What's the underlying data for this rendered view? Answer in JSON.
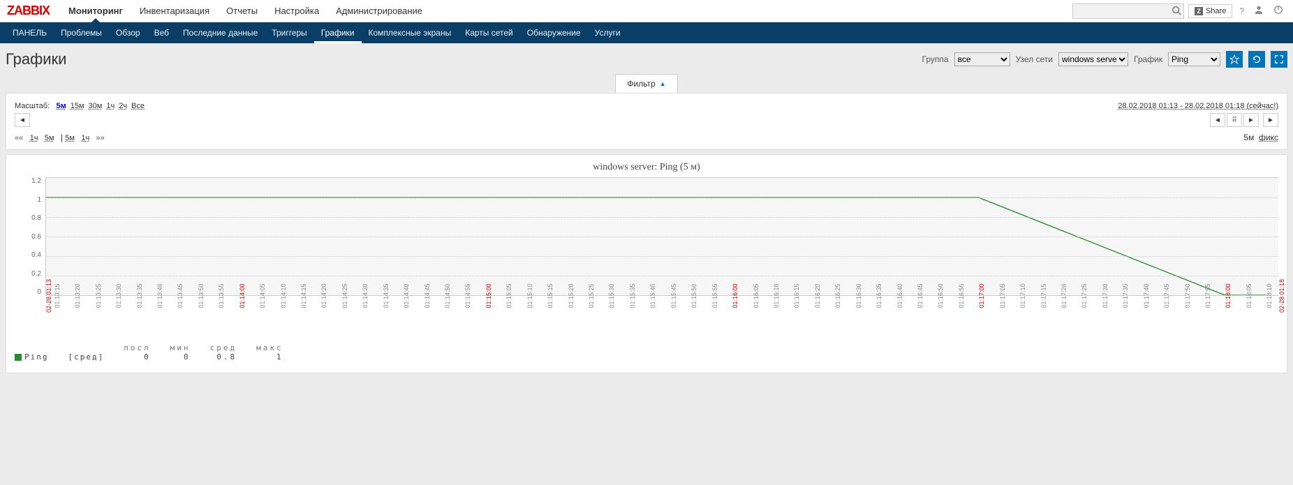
{
  "logo": "ZABBIX",
  "topnav": [
    {
      "label": "Мониторинг",
      "active": true
    },
    {
      "label": "Инвентаризация"
    },
    {
      "label": "Отчеты"
    },
    {
      "label": "Настройка"
    },
    {
      "label": "Администрирование"
    }
  ],
  "share_label": "Share",
  "subnav": [
    {
      "label": "ПАНЕЛЬ"
    },
    {
      "label": "Проблемы"
    },
    {
      "label": "Обзор"
    },
    {
      "label": "Веб"
    },
    {
      "label": "Последние данные"
    },
    {
      "label": "Триггеры"
    },
    {
      "label": "Графики",
      "active": true
    },
    {
      "label": "Комплексные экраны"
    },
    {
      "label": "Карты сетей"
    },
    {
      "label": "Обнаружение"
    },
    {
      "label": "Услуги"
    }
  ],
  "page_title": "Графики",
  "filters": {
    "group_label": "Группа",
    "group_value": "все",
    "host_label": "Узел сети",
    "host_value": "windows server",
    "graph_label": "График",
    "graph_value": "Ping"
  },
  "filter_tab_label": "Фильтр",
  "scale": {
    "label": "Масштаб:",
    "items": [
      "5м",
      "15м",
      "30м",
      "1ч",
      "2ч",
      "Все"
    ],
    "selected": "5м"
  },
  "time_range": "28.02.2018 01:13 - 28.02.2018 01:18 (сейчас!)",
  "move": {
    "prefix": "««",
    "items_left": [
      "1ч",
      "5м"
    ],
    "sep": "|",
    "items_right": [
      "5м",
      "1ч"
    ],
    "suffix": "»»",
    "right_label": "5м",
    "right_fix": "фикс"
  },
  "chart_title": "windows server: Ping (5 м)",
  "chart_data": {
    "type": "line",
    "title": "windows server: Ping (5 м)",
    "ylabel": "",
    "ylim": [
      0,
      1.2
    ],
    "yticks": [
      1.2,
      1.0,
      0.8,
      0.6,
      0.4,
      0.2,
      0
    ],
    "x_start": "02-28 01:13",
    "x_end": "02-28 01:18",
    "x_ticks": [
      "01:13:15",
      "01:13:20",
      "01:13:25",
      "01:13:30",
      "01:13:35",
      "01:13:40",
      "01:13:45",
      "01:13:50",
      "01:13:55",
      "01:14:00",
      "01:14:05",
      "01:14:10",
      "01:14:15",
      "01:14:20",
      "01:14:25",
      "01:14:30",
      "01:14:35",
      "01:14:40",
      "01:14:45",
      "01:14:50",
      "01:14:55",
      "01:15:00",
      "01:15:05",
      "01:15:10",
      "01:15:15",
      "01:15:20",
      "01:15:25",
      "01:15:30",
      "01:15:35",
      "01:15:40",
      "01:15:45",
      "01:15:50",
      "01:15:55",
      "01:16:00",
      "01:16:05",
      "01:16:10",
      "01:16:15",
      "01:16:20",
      "01:16:25",
      "01:16:30",
      "01:16:35",
      "01:16:40",
      "01:16:45",
      "01:16:50",
      "01:16:55",
      "01:17:00",
      "01:17:05",
      "01:17:10",
      "01:17:15",
      "01:17:20",
      "01:17:25",
      "01:17:30",
      "01:17:35",
      "01:17:40",
      "01:17:45",
      "01:17:50",
      "01:17:55",
      "01:18:00",
      "01:18:05",
      "01:18:10"
    ],
    "x_major": [
      "01:14:00",
      "01:15:00",
      "01:16:00",
      "01:17:00",
      "01:18:00"
    ],
    "series": [
      {
        "name": "Ping",
        "agg": "[сред]",
        "color": "#2a8a2a",
        "points": [
          {
            "t": "01:13:13",
            "v": 1
          },
          {
            "t": "01:17:00",
            "v": 1
          },
          {
            "t": "01:18:00",
            "v": 0
          },
          {
            "t": "01:18:10",
            "v": 0
          }
        ],
        "stats": {
          "посл": 0,
          "мин": 0,
          "сред": 0.8,
          "макс": 1
        }
      }
    ]
  }
}
